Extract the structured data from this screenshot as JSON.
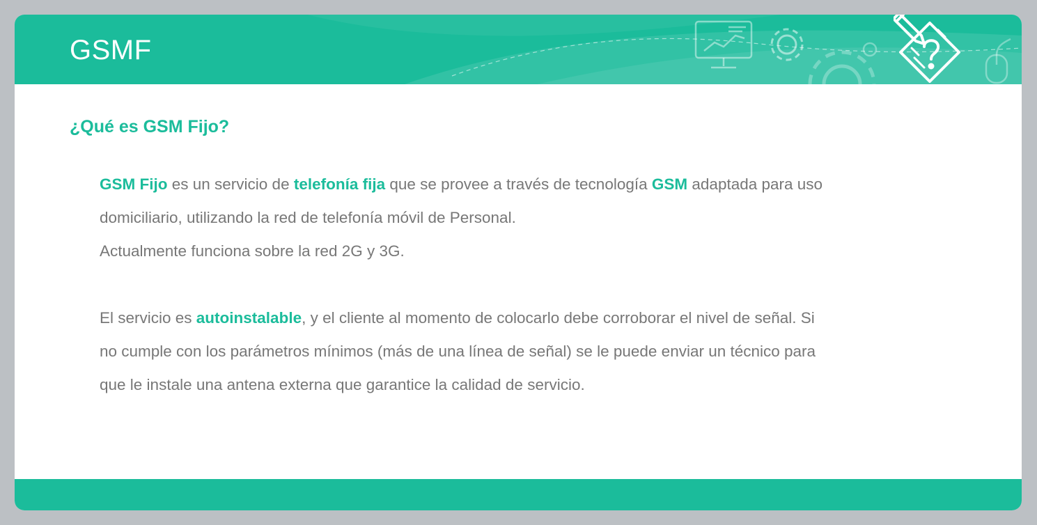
{
  "header": {
    "title": "GSMF",
    "illustration_icon": "pencil-question-diamond-icon"
  },
  "section": {
    "title": "¿Qué es GSM Fijo?"
  },
  "paragraph1": {
    "line1": {
      "hl1": "GSM Fijo",
      "t1": " es un servicio de ",
      "hl2": "telefonía fija",
      "t2": " que se provee a través de tecnología ",
      "hl3": "GSM",
      "t3": " adaptada para uso"
    },
    "line2": "domiciliario, utilizando la red de telefonía móvil de Personal.",
    "line3": "Actualmente funciona sobre la red 2G y 3G."
  },
  "paragraph2": {
    "t1": "El servicio es ",
    "hl1": "autoinstalable",
    "t2": ", y el cliente al momento de colocarlo debe corroborar el nivel de señal. Si",
    "line2": "no cumple con los parámetros mínimos (más de una línea de señal) se le puede enviar un técnico para",
    "line3": "que le instale una antena externa que garantice la calidad de servicio."
  },
  "colors": {
    "accent": "#1bbc9b",
    "background": "#bcc0c4",
    "body_text": "#777777",
    "slide": "#ffffff"
  }
}
